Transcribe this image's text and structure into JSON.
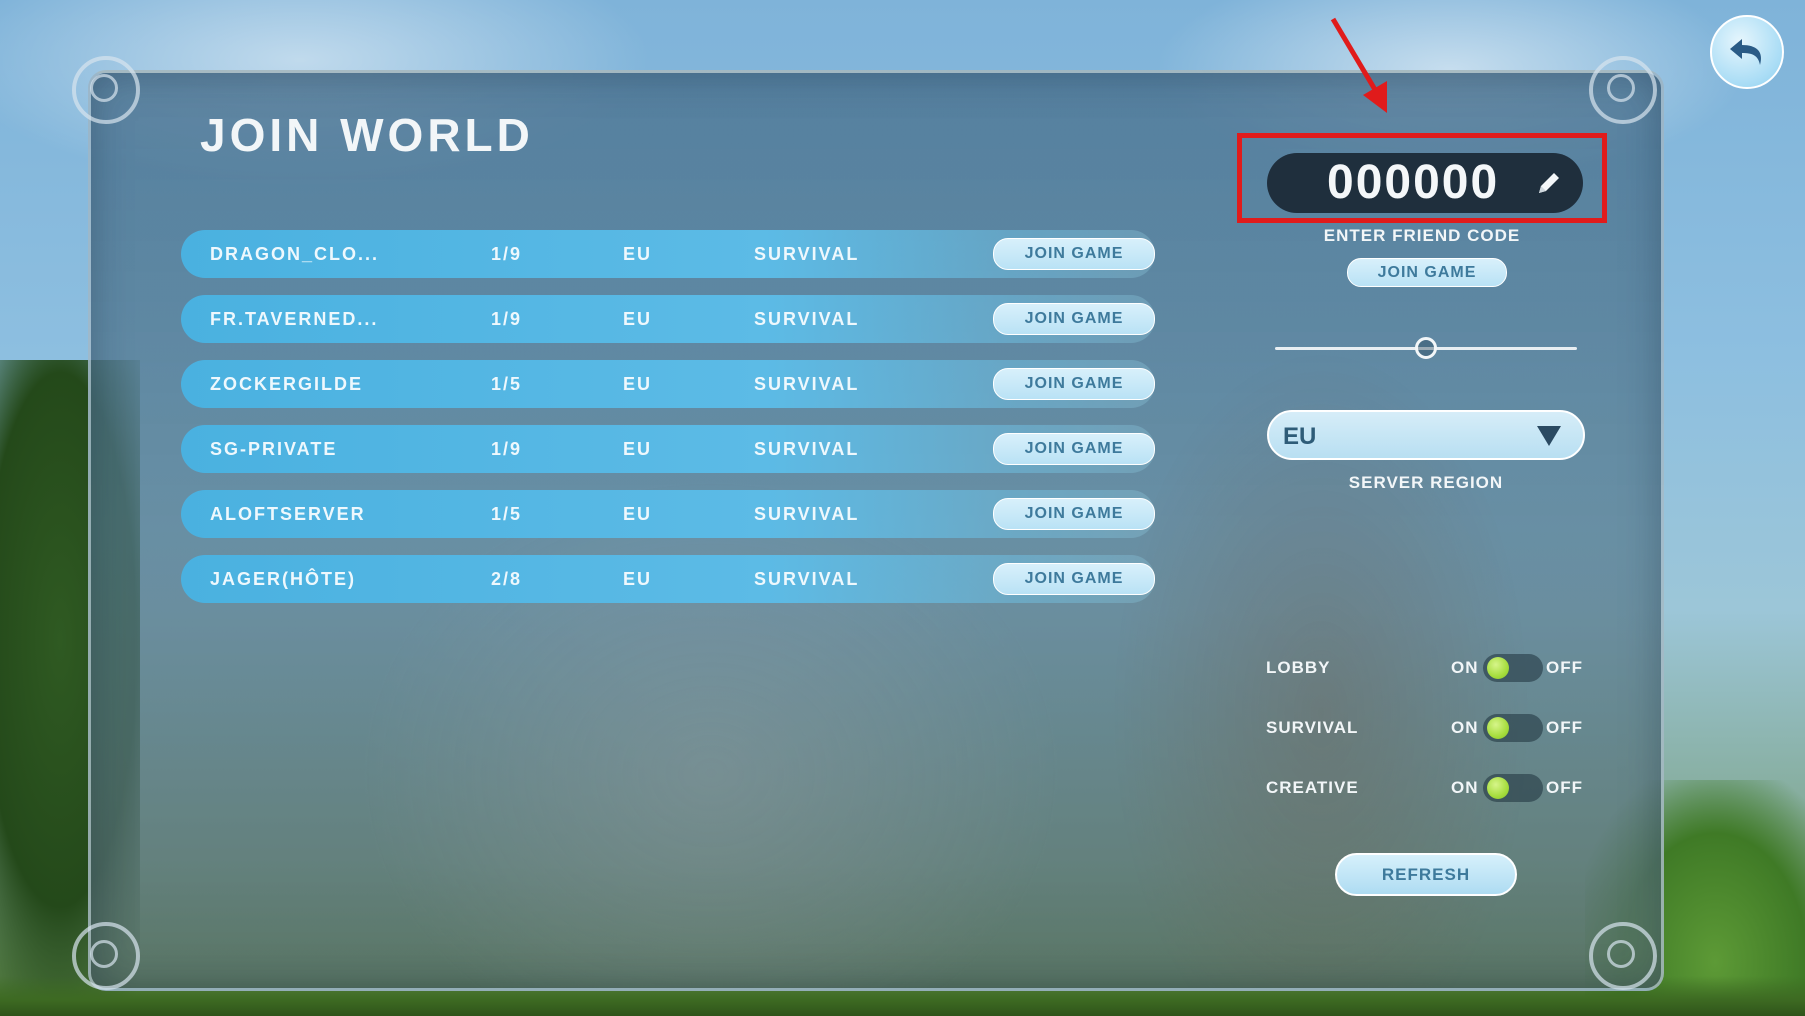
{
  "title": "JOIN WORLD",
  "servers": [
    {
      "name": "DRAGON_CLO...",
      "players": "1/9",
      "region": "EU",
      "mode": "SURVIVAL",
      "join_label": "JOIN GAME"
    },
    {
      "name": "FR.TAVERNED...",
      "players": "1/9",
      "region": "EU",
      "mode": "SURVIVAL",
      "join_label": "JOIN GAME"
    },
    {
      "name": "ZOCKERGILDE",
      "players": "1/5",
      "region": "EU",
      "mode": "SURVIVAL",
      "join_label": "JOIN GAME"
    },
    {
      "name": "SG-PRIVATE",
      "players": "1/9",
      "region": "EU",
      "mode": "SURVIVAL",
      "join_label": "JOIN GAME"
    },
    {
      "name": "ALOFTSERVER",
      "players": "1/5",
      "region": "EU",
      "mode": "SURVIVAL",
      "join_label": "JOIN GAME"
    },
    {
      "name": "JAGER(HÔTE)",
      "players": "2/8",
      "region": "EU",
      "mode": "SURVIVAL",
      "join_label": "JOIN GAME"
    }
  ],
  "friend_code": {
    "value": "000000",
    "label": "ENTER FRIEND CODE",
    "join_label": "JOIN GAME",
    "edit_icon": "pencil-icon",
    "highlight_color": "#e01b1b"
  },
  "slider": {
    "value_fraction": 0.5
  },
  "server_region": {
    "selected": "EU",
    "label": "SERVER REGION"
  },
  "filters": [
    {
      "label": "LOBBY",
      "on_label": "ON",
      "off_label": "OFF",
      "state": "on"
    },
    {
      "label": "SURVIVAL",
      "on_label": "ON",
      "off_label": "OFF",
      "state": "on"
    },
    {
      "label": "CREATIVE",
      "on_label": "ON",
      "off_label": "OFF",
      "state": "on"
    }
  ],
  "refresh_label": "REFRESH",
  "back_icon": "back-arrow-icon",
  "colors": {
    "row": "#4ab1e0",
    "button": "#c8e9f8",
    "toggle_on": "#a6dd3d",
    "annotation": "#e01b1b"
  }
}
